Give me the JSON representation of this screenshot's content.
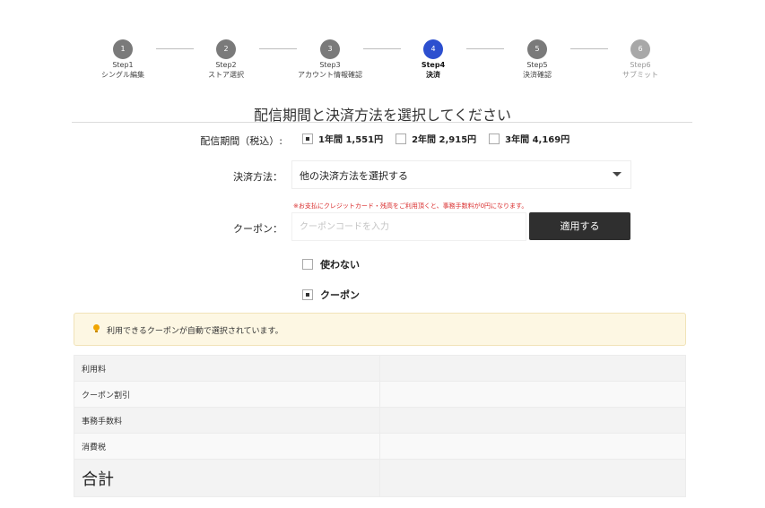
{
  "stepper": {
    "steps": [
      {
        "num": "1",
        "step": "Step1",
        "label": "シングル編集"
      },
      {
        "num": "2",
        "step": "Step2",
        "label": "ストア選択"
      },
      {
        "num": "3",
        "step": "Step3",
        "label": "アカウント情報確認"
      },
      {
        "num": "4",
        "step": "Step4",
        "label": "決済"
      },
      {
        "num": "5",
        "step": "Step5",
        "label": "決済確認"
      },
      {
        "num": "6",
        "step": "Step6",
        "label": "サブミット"
      }
    ],
    "active_step": 4
  },
  "heading": "配信期間と決済方法を選択してください",
  "period": {
    "label": "配信期間（税込）:",
    "options": [
      {
        "label": "1年間 1,551円",
        "checked": true
      },
      {
        "label": "2年間 2,915円",
        "checked": false
      },
      {
        "label": "3年間 4,169円",
        "checked": false
      }
    ]
  },
  "payment": {
    "label": "決済方法：",
    "selected": "他の決済方法を選択する",
    "notice": "※お支払にクレジットカード・残高をご利用頂くと、事務手数料が0円になります。"
  },
  "coupon": {
    "label": "クーポン：",
    "placeholder": "クーポンコードを入力",
    "value": "",
    "apply_label": "適用する",
    "options": [
      {
        "label": "使わない",
        "checked": false
      },
      {
        "label": "クーポン",
        "checked": true
      }
    ]
  },
  "info_message": "利用できるクーポンが自動で選択されています。",
  "summary": {
    "rows": [
      {
        "label": "利用料",
        "value": ""
      },
      {
        "label": "クーポン割引",
        "value": ""
      },
      {
        "label": "事務手数料",
        "value": ""
      },
      {
        "label": "消費税",
        "value": ""
      },
      {
        "label": "合計",
        "value": ""
      }
    ]
  },
  "colors": {
    "active_step": "#2c4fcf",
    "button": "#2f2f2f",
    "notice": "#d92a2a",
    "info_bg": "#fdf7e3"
  }
}
